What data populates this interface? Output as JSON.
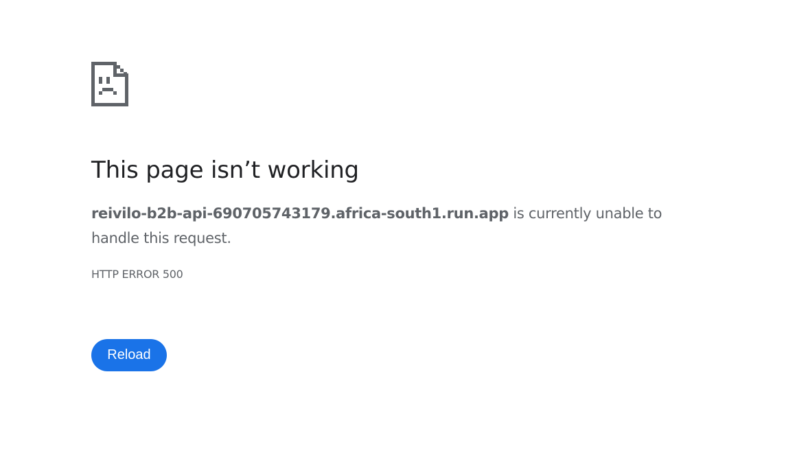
{
  "icon": "sad-page-icon",
  "title": "This page isn’t working",
  "summary": {
    "host": "reivilo-b2b-api-690705743179.africa-south1.run.app",
    "message": " is currently unable to handle this request."
  },
  "error_code": "HTTP ERROR 500",
  "reload_label": "Reload",
  "colors": {
    "title": "#202124",
    "text": "#5f6368",
    "button": "#1a73e8",
    "icon": "#5f6368"
  }
}
